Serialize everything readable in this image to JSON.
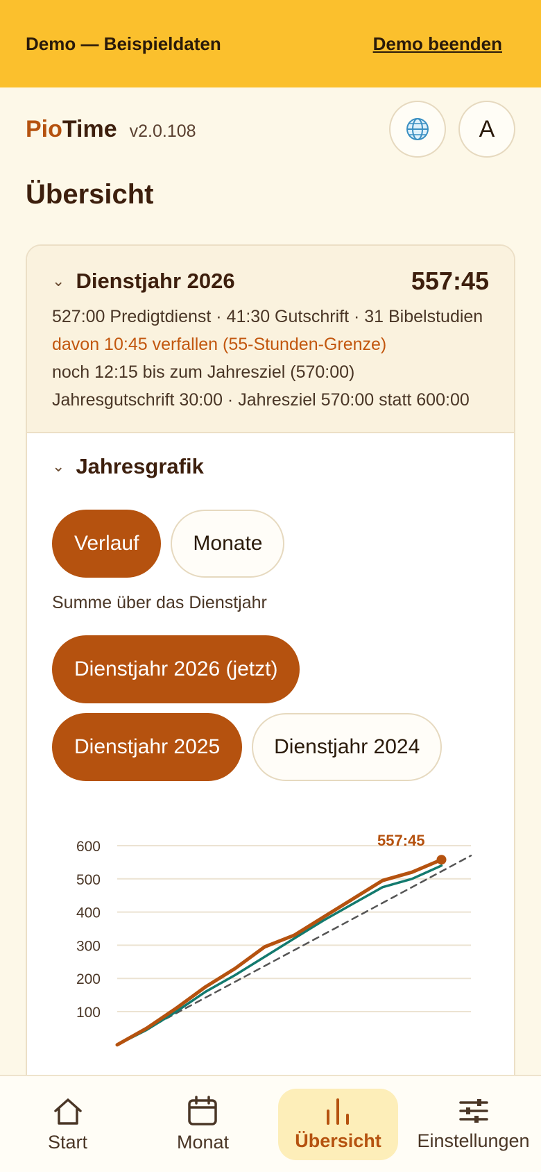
{
  "demo": {
    "text": "Demo — Beispieldaten",
    "exit": "Demo beenden"
  },
  "header": {
    "brand_a": "Pio",
    "brand_b": "Time",
    "version": "v2.0.108",
    "avatar": "A",
    "language_icon": "globe-icon"
  },
  "page": {
    "title": "Übersicht"
  },
  "summary": {
    "title": "Dienstjahr 2026",
    "total": "557:45",
    "line1": "527:00 Predigtdienst · 41:30 Gutschrift · 31 Bibelstudien",
    "line2": "davon 10:45 verfallen (55-Stunden-Grenze)",
    "line3": "noch 12:15 bis zum Jahresziel (570:00)",
    "line4": "Jahresgutschrift 30:00 · Jahresziel 570:00 statt 600:00"
  },
  "chart_section": {
    "title": "Jahresgrafik",
    "mode_verlauf": "Verlauf",
    "mode_monate": "Monate",
    "subtitle": "Summe über das Dienstjahr",
    "year_2026": "Dienstjahr 2026 (jetzt)",
    "year_2025": "Dienstjahr 2025",
    "year_2024": "Dienstjahr 2024"
  },
  "colors": {
    "accent": "#b5520f",
    "demo_bar": "#fbc02d",
    "series_2025": "#137a6e",
    "goal_line": "#555555"
  },
  "chart_data": {
    "type": "line",
    "x": [
      0,
      1,
      2,
      3,
      4,
      5,
      6,
      7,
      8,
      9,
      10,
      11,
      12
    ],
    "ylim": [
      0,
      600
    ],
    "yticks": [
      100,
      200,
      300,
      400,
      500,
      600
    ],
    "grid": true,
    "end_label": "557:45",
    "series": [
      {
        "color": "#b5520f",
        "values": [
          0,
          50,
          110,
          175,
          230,
          295,
          330,
          385,
          440,
          495,
          520,
          557.75
        ]
      },
      {
        "color": "#137a6e",
        "values": [
          0,
          45,
          100,
          160,
          210,
          265,
          320,
          375,
          425,
          475,
          500,
          540
        ]
      },
      {
        "color": "#555555",
        "dashed": true,
        "values": [
          0,
          47.5,
          95,
          142.5,
          190,
          237.5,
          285,
          332.5,
          380,
          427.5,
          475,
          522.5,
          570
        ]
      }
    ]
  },
  "tabs": [
    {
      "label": "Start",
      "icon": "house-icon"
    },
    {
      "label": "Monat",
      "icon": "calendar-icon"
    },
    {
      "label": "Übersicht",
      "icon": "bar-chart-icon"
    },
    {
      "label": "Einstellungen",
      "icon": "sliders-icon"
    }
  ]
}
